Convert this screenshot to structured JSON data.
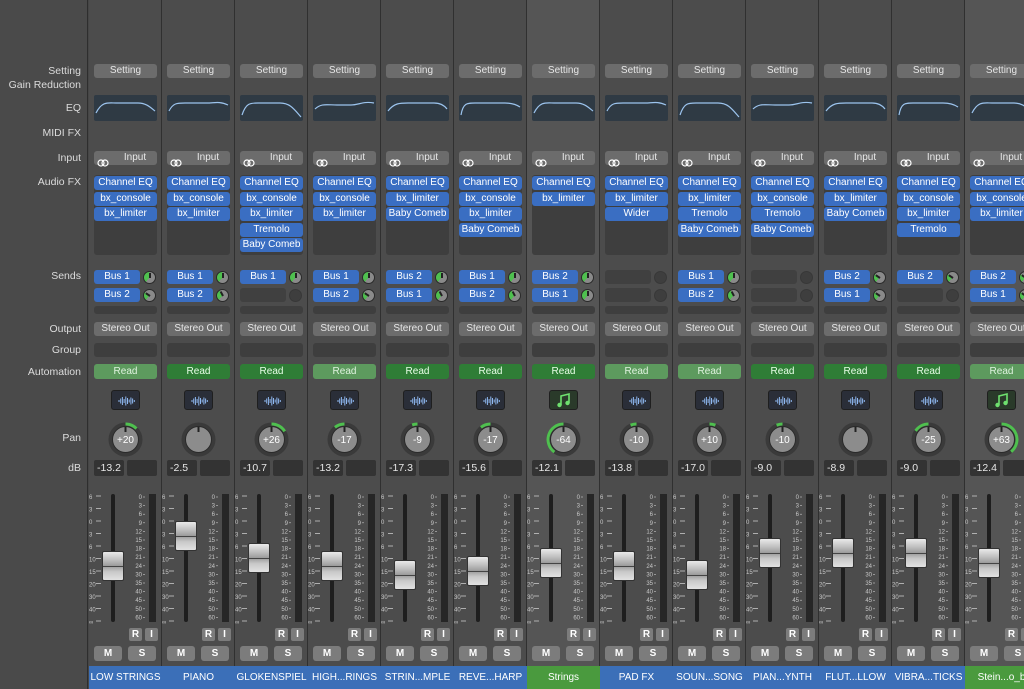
{
  "row_labels": {
    "setting": "Setting",
    "gain_reduction": "Gain Reduction",
    "eq": "EQ",
    "midi_fx": "MIDI FX",
    "input": "Input",
    "audio_fx": "Audio FX",
    "sends": "Sends",
    "output": "Output",
    "group": "Group",
    "automation": "Automation",
    "pan": "Pan",
    "db": "dB"
  },
  "left_scale": [
    "6",
    "3",
    "0",
    "3",
    "6",
    "10",
    "15",
    "20",
    "30",
    "40",
    "∞"
  ],
  "meter_scale": [
    "0",
    "3",
    "6",
    "9",
    "12",
    "15",
    "18",
    "21",
    "24",
    "30",
    "35",
    "40",
    "45",
    "50",
    "60"
  ],
  "colors": {
    "plugin_blue": "#3a6ec2",
    "name_blue": "#3b6fb8",
    "name_green": "#4a9a3e",
    "pan_green": "#4fc04f",
    "read_dark": "#2f7d36",
    "read_light": "#5d9a5e"
  },
  "strips": [
    {
      "setting": "Setting",
      "input": "Input",
      "fx": [
        "Channel EQ",
        "bx_console",
        "bx_limiter"
      ],
      "sends": [
        {
          "label": "Bus 1",
          "level": 0.5
        },
        {
          "label": "Bus 2",
          "level": 0.3
        }
      ],
      "output": "Stereo Out",
      "automation": "Read",
      "auto_style": "light",
      "icon": "waveform-icon",
      "pan": "+20",
      "db": "-13.2",
      "fader_level": 0.42,
      "record": "R",
      "input_mon": "I",
      "mute": "M",
      "solo": "S",
      "name": "LOW STRINGS",
      "name_style": "blue"
    },
    {
      "setting": "Setting",
      "input": "Input",
      "fx": [
        "Channel EQ",
        "bx_console",
        "bx_limiter"
      ],
      "sends": [
        {
          "label": "Bus 1",
          "level": 0.5
        },
        {
          "label": "Bus 2",
          "level": 0.4
        }
      ],
      "output": "Stereo Out",
      "automation": "Read",
      "auto_style": "dark",
      "icon": "waveform-icon",
      "pan": "",
      "db": "-2.5",
      "fader_level": 0.72,
      "record": "R",
      "input_mon": "I",
      "mute": "M",
      "solo": "S",
      "name": "PIANO",
      "name_style": "blue"
    },
    {
      "setting": "Setting",
      "input": "Input",
      "fx": [
        "Channel EQ",
        "bx_console",
        "bx_limiter",
        "Tremolo",
        "Baby Comeb"
      ],
      "sends": [
        {
          "label": "Bus 1",
          "level": 0.5
        },
        {
          "label": "",
          "level": 0
        }
      ],
      "output": "Stereo Out",
      "automation": "Read",
      "auto_style": "dark",
      "icon": "waveform-icon",
      "pan": "+26",
      "db": "-10.7",
      "fader_level": 0.5,
      "record": "R",
      "input_mon": "I",
      "mute": "M",
      "solo": "S",
      "name": "GLOKENSPIEL",
      "name_style": "blue"
    },
    {
      "setting": "Setting",
      "input": "Input",
      "fx": [
        "Channel EQ",
        "bx_console",
        "bx_limiter"
      ],
      "sends": [
        {
          "label": "Bus 1",
          "level": 0.5
        },
        {
          "label": "Bus 2",
          "level": 0.3
        }
      ],
      "output": "Stereo Out",
      "automation": "Read",
      "auto_style": "light",
      "icon": "waveform-icon",
      "pan": "-17",
      "db": "-13.2",
      "fader_level": 0.42,
      "record": "R",
      "input_mon": "I",
      "mute": "M",
      "solo": "S",
      "name": "HIGH...RINGS",
      "name_style": "blue"
    },
    {
      "setting": "Setting",
      "input": "Input",
      "fx": [
        "Channel EQ",
        "bx_limiter",
        "Baby Comeb"
      ],
      "sends": [
        {
          "label": "Bus 2",
          "level": 0.5
        },
        {
          "label": "Bus 1",
          "level": 0.4
        }
      ],
      "output": "Stereo Out",
      "automation": "Read",
      "auto_style": "dark",
      "icon": "waveform-icon",
      "pan": "-9",
      "db": "-17.3",
      "fader_level": 0.33,
      "record": "R",
      "input_mon": "I",
      "mute": "M",
      "solo": "S",
      "name": "STRIN...MPLE",
      "name_style": "blue"
    },
    {
      "setting": "Setting",
      "input": "Input",
      "fx": [
        "Channel EQ",
        "bx_console",
        "bx_limiter",
        "Baby Comeb"
      ],
      "sends": [
        {
          "label": "Bus 1",
          "level": 0.5
        },
        {
          "label": "Bus 2",
          "level": 0.4
        }
      ],
      "output": "Stereo Out",
      "automation": "Read",
      "auto_style": "dark",
      "icon": "waveform-icon",
      "pan": "-17",
      "db": "-15.6",
      "fader_level": 0.37,
      "record": "R",
      "input_mon": "I",
      "mute": "M",
      "solo": "S",
      "name": "REVE...HARP",
      "name_style": "blue"
    },
    {
      "setting": "Setting",
      "input": "Input",
      "fx": [
        "Channel EQ",
        "bx_limiter"
      ],
      "sends": [
        {
          "label": "Bus 2",
          "level": 0.5
        },
        {
          "label": "Bus 1",
          "level": 0.5
        }
      ],
      "output": "Stereo Out",
      "automation": "Read",
      "auto_style": "dark",
      "icon": "music-note-icon",
      "pan": "-64",
      "db": "-12.1",
      "fader_level": 0.45,
      "record": "R",
      "input_mon": "I",
      "mute": "M",
      "solo": "S",
      "name": "Strings",
      "name_style": "green"
    },
    {
      "setting": "Setting",
      "input": "Input",
      "fx": [
        "Channel EQ",
        "bx_limiter",
        "Wider"
      ],
      "sends": [
        {
          "label": "",
          "level": 0
        },
        {
          "label": "",
          "level": 0
        }
      ],
      "output": "Stereo Out",
      "automation": "Read",
      "auto_style": "light",
      "icon": "waveform-icon",
      "pan": "-10",
      "db": "-13.8",
      "fader_level": 0.42,
      "record": "R",
      "input_mon": "I",
      "mute": "M",
      "solo": "S",
      "name": "PAD FX",
      "name_style": "blue"
    },
    {
      "setting": "Setting",
      "input": "Input",
      "fx": [
        "Channel EQ",
        "bx_limiter",
        "Tremolo",
        "Baby Comeb"
      ],
      "sends": [
        {
          "label": "Bus 1",
          "level": 0.5
        },
        {
          "label": "Bus 2",
          "level": 0.4
        }
      ],
      "output": "Stereo Out",
      "automation": "Read",
      "auto_style": "light",
      "icon": "waveform-icon",
      "pan": "+10",
      "db": "-17.0",
      "fader_level": 0.33,
      "record": "R",
      "input_mon": "I",
      "mute": "M",
      "solo": "S",
      "name": "SOUN...SONG",
      "name_style": "blue"
    },
    {
      "setting": "Setting",
      "input": "Input",
      "fx": [
        "Channel EQ",
        "bx_console",
        "Tremolo",
        "Baby Comeb"
      ],
      "sends": [
        {
          "label": "",
          "level": 0
        },
        {
          "label": "",
          "level": 0
        }
      ],
      "output": "Stereo Out",
      "automation": "Read",
      "auto_style": "dark",
      "icon": "waveform-icon",
      "pan": "-10",
      "db": "-9.0",
      "fader_level": 0.55,
      "record": "R",
      "input_mon": "I",
      "mute": "M",
      "solo": "S",
      "name": "PIAN...YNTH",
      "name_style": "blue"
    },
    {
      "setting": "Setting",
      "input": "Input",
      "fx": [
        "Channel EQ",
        "bx_limiter",
        "Baby Comeb"
      ],
      "sends": [
        {
          "label": "Bus 2",
          "level": 0.3
        },
        {
          "label": "Bus 1",
          "level": 0.3
        }
      ],
      "output": "Stereo Out",
      "automation": "Read",
      "auto_style": "dark",
      "icon": "waveform-icon",
      "pan": "",
      "db": "-8.9",
      "fader_level": 0.55,
      "record": "R",
      "input_mon": "I",
      "mute": "M",
      "solo": "S",
      "name": "FLUT...LLOW",
      "name_style": "blue"
    },
    {
      "setting": "Setting",
      "input": "Input",
      "fx": [
        "Channel EQ",
        "bx_console",
        "bx_limiter",
        "Tremolo"
      ],
      "sends": [
        {
          "label": "Bus 2",
          "level": 0.3
        },
        {
          "label": "",
          "level": 0
        }
      ],
      "output": "Stereo Out",
      "automation": "Read",
      "auto_style": "dark",
      "icon": "waveform-icon",
      "pan": "-25",
      "db": "-9.0",
      "fader_level": 0.55,
      "record": "R",
      "input_mon": "I",
      "mute": "M",
      "solo": "S",
      "name": "VIBRA...TICKS",
      "name_style": "blue"
    },
    {
      "setting": "Setting",
      "input": "Input",
      "fx": [
        "Channel EQ",
        "bx_console",
        "bx_limiter"
      ],
      "sends": [
        {
          "label": "Bus 2",
          "level": 0.3
        },
        {
          "label": "Bus 1",
          "level": 0.3
        }
      ],
      "output": "Stereo Out",
      "automation": "Read",
      "auto_style": "light",
      "icon": "music-note-icon",
      "pan": "+63",
      "db": "-12.4",
      "fader_level": 0.45,
      "record": "R",
      "input_mon": "I",
      "mute": "M",
      "solo": "S",
      "name": "Stein...o_b",
      "name_style": "green"
    }
  ]
}
